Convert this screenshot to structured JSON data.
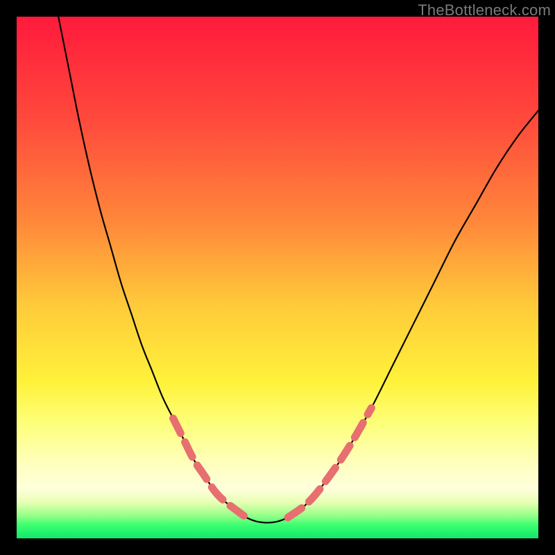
{
  "watermark": "TheBottleneck.com",
  "colors": {
    "black": "#000000",
    "curve": "#000000",
    "dash": "#e76f6f",
    "gradient_stops": [
      {
        "offset": 0.0,
        "color": "#ff1a3c"
      },
      {
        "offset": 0.2,
        "color": "#ff4a3c"
      },
      {
        "offset": 0.4,
        "color": "#ff8a3a"
      },
      {
        "offset": 0.55,
        "color": "#ffc93a"
      },
      {
        "offset": 0.7,
        "color": "#fff23a"
      },
      {
        "offset": 0.78,
        "color": "#fdff7a"
      },
      {
        "offset": 0.86,
        "color": "#ffffc0"
      },
      {
        "offset": 0.905,
        "color": "#ffffdc"
      },
      {
        "offset": 0.93,
        "color": "#e9ffb5"
      },
      {
        "offset": 0.955,
        "color": "#9bff8a"
      },
      {
        "offset": 0.975,
        "color": "#3aff70"
      },
      {
        "offset": 1.0,
        "color": "#10e86a"
      }
    ]
  },
  "chart_data": {
    "type": "line",
    "title": "",
    "xlabel": "",
    "ylabel": "",
    "xlim": [
      0,
      100
    ],
    "ylim": [
      0,
      100
    ],
    "legend": null,
    "grid": false,
    "series": [
      {
        "name": "bottleneck-curve",
        "x": [
          8,
          10,
          12,
          14,
          16,
          18,
          20,
          22,
          24,
          26,
          28,
          30,
          32,
          34,
          36,
          38,
          40,
          44,
          48,
          52,
          56,
          60,
          64,
          68,
          72,
          76,
          80,
          84,
          88,
          92,
          96,
          100
        ],
        "y": [
          100,
          90,
          80,
          71,
          63,
          56,
          49,
          43,
          37,
          32,
          27,
          23,
          19,
          15,
          12,
          9,
          7,
          4,
          3,
          4,
          7,
          12,
          18,
          25,
          33,
          41,
          49,
          57,
          64,
          71,
          77,
          82
        ]
      }
    ],
    "highlight_segments": {
      "description": "Thick salmon dashed overlays on the lower portion of the curve near the valley",
      "left_branch_y_range": [
        4,
        25
      ],
      "right_branch_y_range": [
        4,
        28
      ]
    },
    "background": {
      "type": "vertical-gradient",
      "description": "Red at top → orange → yellow → pale yellow → green at bottom"
    }
  }
}
